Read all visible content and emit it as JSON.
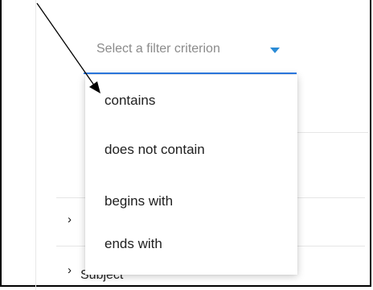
{
  "filter": {
    "placeholder": "Select a filter criterion",
    "accent_color": "#2c7be5"
  },
  "menu": {
    "items": [
      {
        "label": "contains"
      },
      {
        "label": "does not contain"
      },
      {
        "label": "begins with"
      },
      {
        "label": "ends with"
      }
    ]
  },
  "background": {
    "row_label": "Subject"
  },
  "icons": {
    "dropdown": "chevron-down-icon",
    "expand": "chevron-right-icon",
    "annotation": "arrow-icon"
  }
}
